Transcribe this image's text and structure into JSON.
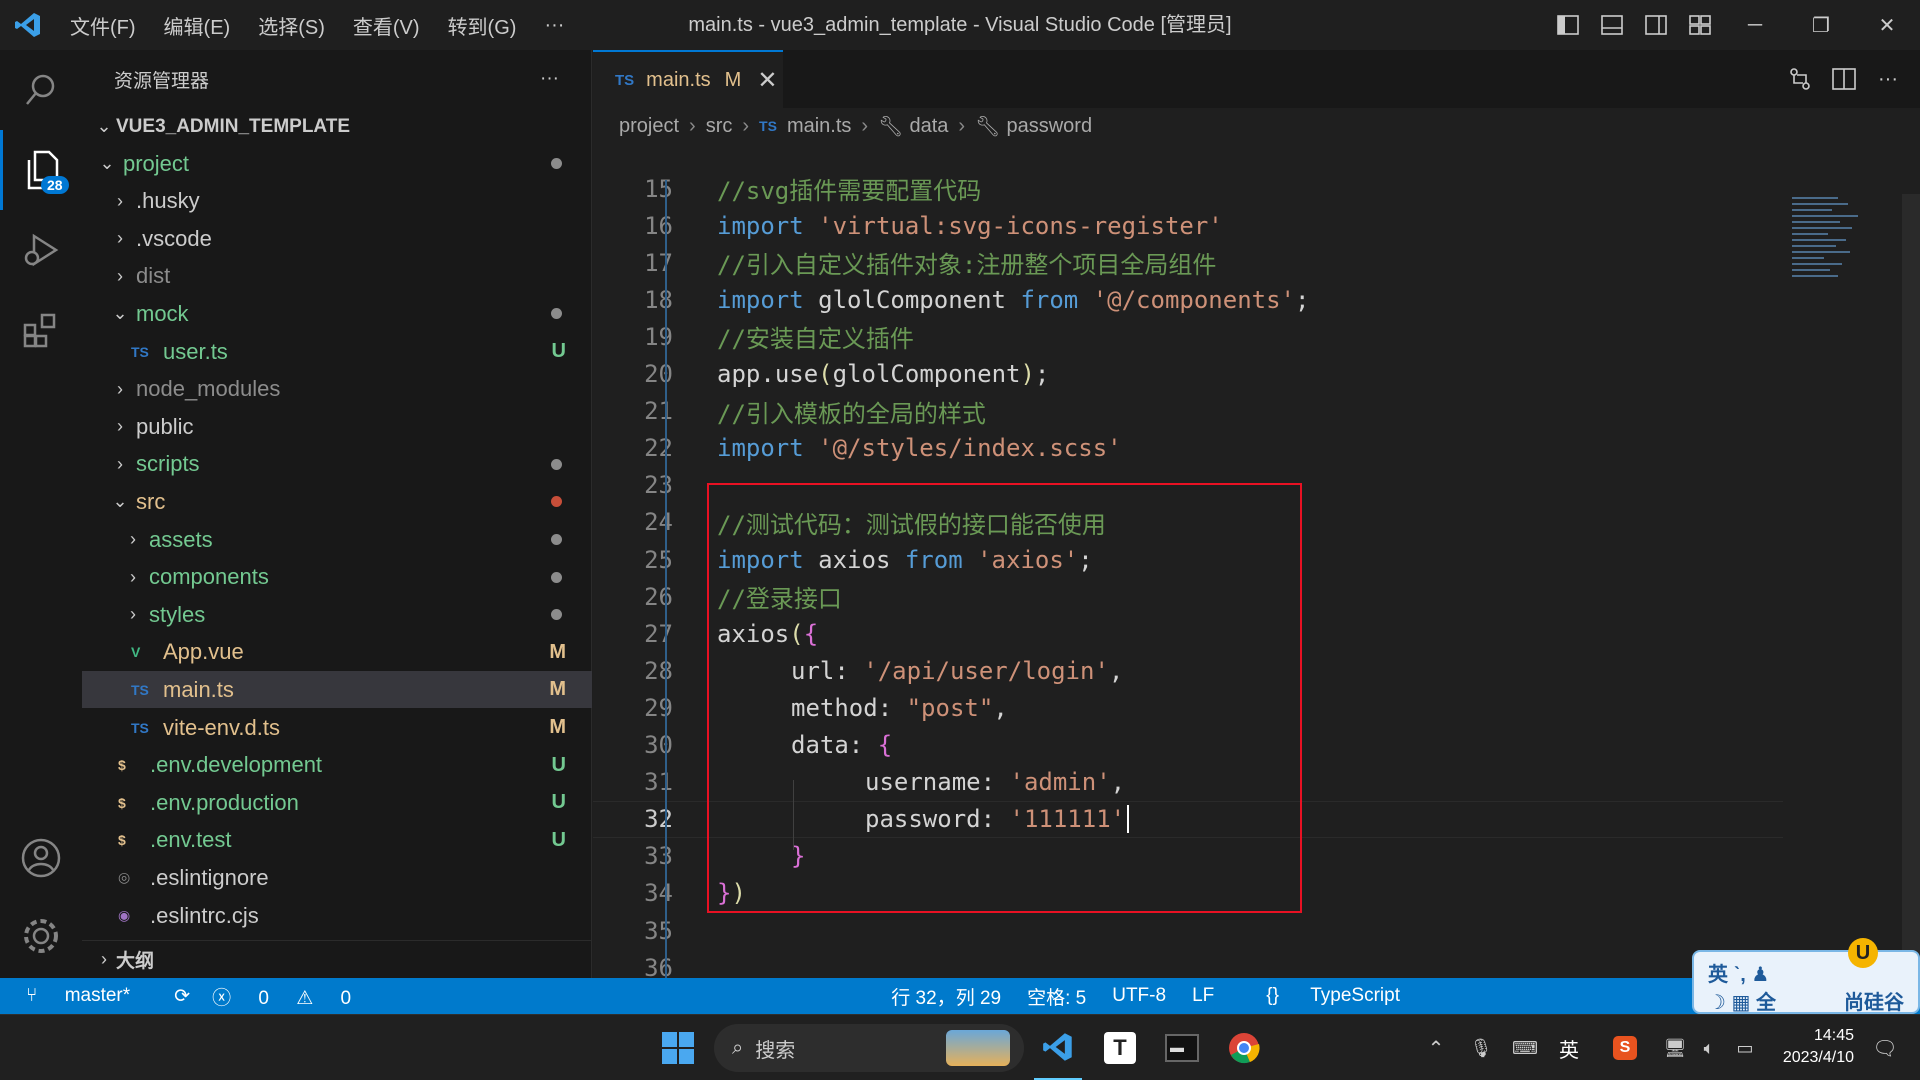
{
  "titlebar": {
    "menu": [
      "文件(F)",
      "编辑(E)",
      "选择(S)",
      "查看(V)",
      "转到(G)",
      "···"
    ],
    "title": "main.ts - vue3_admin_template - Visual Studio Code [管理员]"
  },
  "activity": {
    "explorer_badge": "28"
  },
  "sidebar": {
    "title": "资源管理器",
    "more": "···",
    "root": "VUE3_ADMIN_TEMPLATE",
    "outline": "大纲",
    "items": [
      {
        "label": "project",
        "status": "",
        "color": "#73c991"
      },
      {
        "label": ".husky",
        "status": "",
        "color": "#cccccc"
      },
      {
        "label": ".vscode",
        "status": "",
        "color": "#cccccc"
      },
      {
        "label": "dist",
        "status": "",
        "color": "#8c8c8c"
      },
      {
        "label": "mock",
        "status": "",
        "color": "#73c991"
      },
      {
        "label": "user.ts",
        "status": "U",
        "color": "#73c991",
        "icon": "TS"
      },
      {
        "label": "node_modules",
        "status": "",
        "color": "#8c8c8c"
      },
      {
        "label": "public",
        "status": "",
        "color": "#cccccc"
      },
      {
        "label": "scripts",
        "status": "",
        "color": "#73c991"
      },
      {
        "label": "src",
        "status": "",
        "color": "#e2c08d"
      },
      {
        "label": "assets",
        "status": "",
        "color": "#73c991"
      },
      {
        "label": "components",
        "status": "",
        "color": "#73c991"
      },
      {
        "label": "styles",
        "status": "",
        "color": "#73c991"
      },
      {
        "label": "App.vue",
        "status": "M",
        "color": "#e2c08d",
        "icon": "V"
      },
      {
        "label": "main.ts",
        "status": "M",
        "color": "#e2c08d",
        "icon": "TS"
      },
      {
        "label": "vite-env.d.ts",
        "status": "M",
        "color": "#e2c08d",
        "icon": "TS"
      },
      {
        "label": ".env.development",
        "status": "U",
        "color": "#73c991",
        "icon": "$"
      },
      {
        "label": ".env.production",
        "status": "U",
        "color": "#73c991",
        "icon": "$"
      },
      {
        "label": ".env.test",
        "status": "U",
        "color": "#73c991",
        "icon": "$"
      },
      {
        "label": ".eslintignore",
        "status": "",
        "color": "#cccccc",
        "icon": "◎"
      },
      {
        "label": ".eslintrc.cjs",
        "status": "",
        "color": "#cccccc",
        "icon": "◉"
      }
    ]
  },
  "editor": {
    "tab": {
      "badge": "TS",
      "name": "main.ts",
      "modified": "M",
      "close": "✕"
    },
    "breadcrumb": [
      "project",
      "src",
      "main.ts",
      "data",
      "password"
    ],
    "breadcrumb_ts": "TS",
    "lines": [
      {
        "n": "15",
        "text": "//svg插件需要配置代码"
      },
      {
        "n": "16",
        "text": "import 'virtual:svg-icons-register'"
      },
      {
        "n": "17",
        "text": "//引入自定义插件对象:注册整个项目全局组件"
      },
      {
        "n": "18",
        "text": "import glolComponent from '@/components';"
      },
      {
        "n": "19",
        "text": "//安装自定义插件"
      },
      {
        "n": "20",
        "text": "app.use(glolComponent);"
      },
      {
        "n": "21",
        "text": "//引入模板的全局的样式"
      },
      {
        "n": "22",
        "text": "import '@/styles/index.scss'"
      },
      {
        "n": "23",
        "text": ""
      },
      {
        "n": "24",
        "text": "//测试代码：测试假的接口能否使用"
      },
      {
        "n": "25",
        "text": "import axios from 'axios';"
      },
      {
        "n": "26",
        "text": "//登录接口"
      },
      {
        "n": "27",
        "text": "axios({"
      },
      {
        "n": "28",
        "text": "url: '/api/user/login',"
      },
      {
        "n": "29",
        "text": "method: \"post\","
      },
      {
        "n": "30",
        "text": "data: {"
      },
      {
        "n": "31",
        "text": "username: 'admin',"
      },
      {
        "n": "32",
        "text": "password: '111111'"
      },
      {
        "n": "33",
        "text": "}"
      },
      {
        "n": "34",
        "text": "})"
      },
      {
        "n": "35",
        "text": ""
      },
      {
        "n": "36",
        "text": ""
      }
    ]
  },
  "statusbar": {
    "branch": "master*",
    "errors": "0",
    "warnings": "0",
    "position": "行 32，列 29",
    "spaces": "空格: 5",
    "encoding": "UTF-8",
    "eol": "LF",
    "language": "TypeScript"
  },
  "ime": {
    "line1": "英 ˋ, ♟",
    "line2": "☽ ▦ 全",
    "brand": "尚硅谷"
  },
  "taskbar": {
    "search": "搜索",
    "lang": "英",
    "time": "14:45",
    "date": "2023/4/10"
  },
  "colors": {
    "accent": "#0078d4",
    "statusbar": "#007acc",
    "highlight": "#e81123"
  }
}
